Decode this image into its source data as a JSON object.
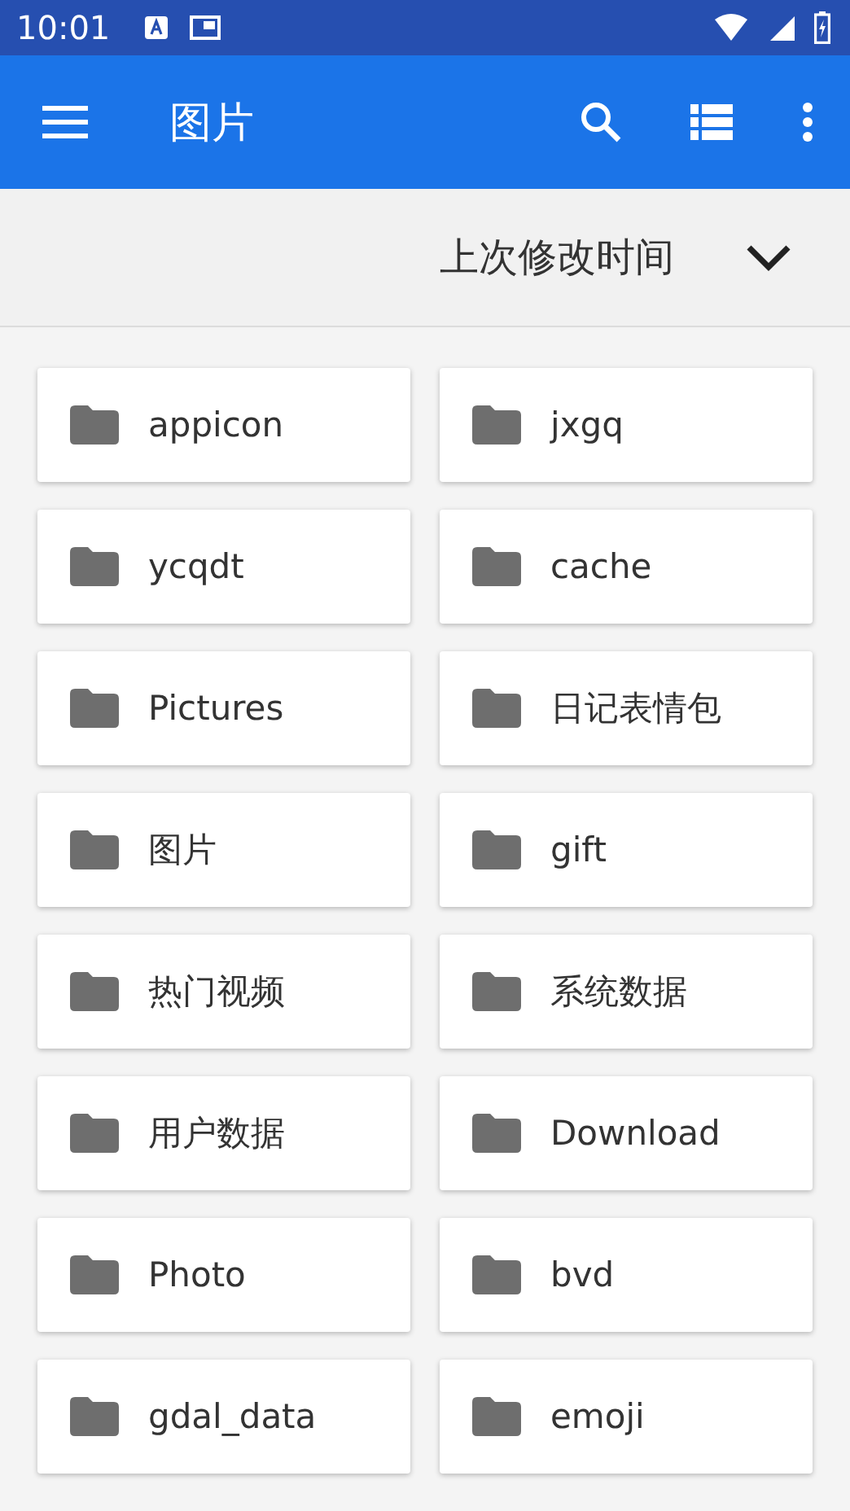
{
  "status_bar": {
    "time": "10:01"
  },
  "app_bar": {
    "title": "图片"
  },
  "sort_bar": {
    "label": "上次修改时间"
  },
  "folders": [
    {
      "name": "appicon"
    },
    {
      "name": "jxgq"
    },
    {
      "name": "ycqdt"
    },
    {
      "name": "cache"
    },
    {
      "name": "Pictures"
    },
    {
      "name": "日记表情包"
    },
    {
      "name": "图片"
    },
    {
      "name": "gift"
    },
    {
      "name": "热门视频"
    },
    {
      "name": "系统数据"
    },
    {
      "name": "用户数据"
    },
    {
      "name": "Download"
    },
    {
      "name": "Photo"
    },
    {
      "name": "bvd"
    },
    {
      "name": "gdal_data"
    },
    {
      "name": "emoji"
    }
  ]
}
